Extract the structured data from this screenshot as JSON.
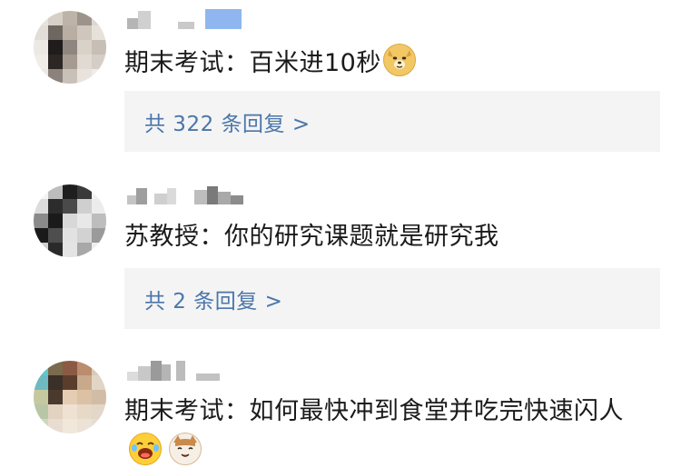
{
  "comments": [
    {
      "text": "期末考试：百米进10秒",
      "emoji": "doge-face-icon",
      "reply_label": "共 322 条回复 >"
    },
    {
      "text": "苏教授：你的研究课题就是研究我",
      "reply_label": "共 2 条回复 >"
    },
    {
      "text": "期末考试：如何最快冲到食堂并吃完快速闪人",
      "emojis": [
        "laughing-face-icon",
        "cat-face-icon"
      ]
    }
  ],
  "colors": {
    "reply_link": "#4a76a8",
    "reply_bg": "#f4f4f5",
    "text": "#1a1a1a"
  }
}
